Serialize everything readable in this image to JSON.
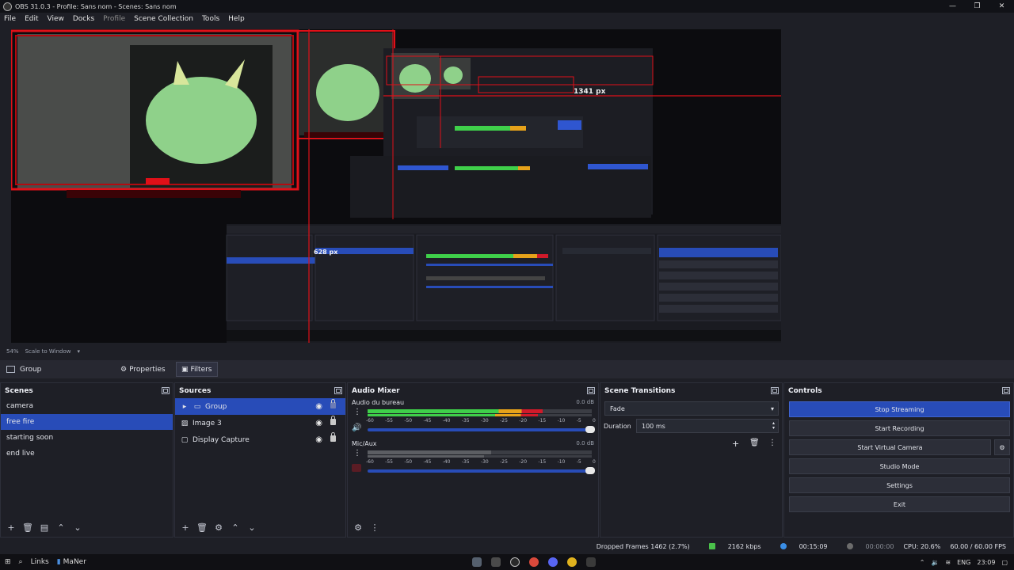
{
  "window": {
    "title": "OBS 31.0.3 - Profile: Sans nom - Scenes: Sans nom",
    "controls": [
      "—",
      "❐",
      "✕"
    ]
  },
  "menu": {
    "items": [
      {
        "label": "File",
        "enabled": true
      },
      {
        "label": "Edit",
        "enabled": true
      },
      {
        "label": "View",
        "enabled": true
      },
      {
        "label": "Docks",
        "enabled": true
      },
      {
        "label": "Profile",
        "enabled": false
      },
      {
        "label": "Scene Collection",
        "enabled": true
      },
      {
        "label": "Tools",
        "enabled": true
      },
      {
        "label": "Help",
        "enabled": true
      }
    ]
  },
  "preview": {
    "measure_horizontal": "1341 px",
    "measure_vertical": "628 px",
    "zoom": "54%",
    "scale_label": "Scale to Window"
  },
  "selection": {
    "name": "Group",
    "properties_label": "Properties",
    "filters_label": "Filters"
  },
  "scenes": {
    "title": "Scenes",
    "items": [
      "camera",
      "free fire",
      "starting soon",
      "end live"
    ],
    "selected": "free fire"
  },
  "sources": {
    "title": "Sources",
    "items": [
      {
        "label": "Group",
        "icon": "folder-icon",
        "selected": true,
        "locked": false
      },
      {
        "label": "Image 3",
        "icon": "image-icon",
        "selected": false,
        "locked": true
      },
      {
        "label": "Display Capture",
        "icon": "monitor-icon",
        "selected": false,
        "locked": true
      }
    ]
  },
  "mixer": {
    "title": "Audio Mixer",
    "ticks": [
      "-60",
      "-55",
      "-50",
      "-45",
      "-40",
      "-35",
      "-30",
      "-25",
      "-20",
      "-15",
      "-10",
      "-5",
      "0"
    ],
    "channels": [
      {
        "name": "Audio du bureau",
        "db": "0.0 dB",
        "level_fraction": 0.78,
        "muted": false
      },
      {
        "name": "Mic/Aux",
        "db": "0.0 dB",
        "level_fraction": 0.55,
        "muted": true
      }
    ]
  },
  "transitions": {
    "title": "Scene Transitions",
    "type": "Fade",
    "duration_label": "Duration",
    "duration_value": "100 ms"
  },
  "controls": {
    "title": "Controls",
    "buttons": [
      "Stop Streaming",
      "Start Recording",
      "Start Virtual Camera",
      "Studio Mode",
      "Settings",
      "Exit"
    ]
  },
  "status": {
    "dropped": "Dropped Frames 1462 (2.7%)",
    "bitrate": "2162 kbps",
    "stream_time": "00:15:09",
    "rec_time": "00:00:00",
    "cpu": "CPU: 20.6%",
    "fps": "60.00 / 60.00 FPS",
    "colors": {
      "bitrate": "#4ac14a",
      "stream": "#3a8ee6",
      "rec": "#6c6c6c"
    }
  },
  "taskbar": {
    "links": "Links",
    "app": "MaNer",
    "lang": "ENG",
    "time": "23:09"
  },
  "colors": {
    "accent": "#284cb8",
    "overlay_red": "#d0101a"
  }
}
